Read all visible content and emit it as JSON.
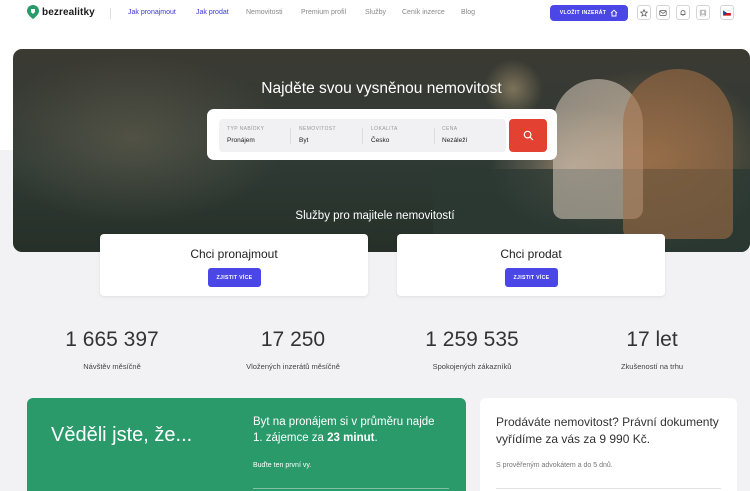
{
  "header": {
    "logo_text": "bezrealitky",
    "nav": [
      {
        "label": "Jak pronajmout",
        "active": true
      },
      {
        "label": "Jak prodat",
        "active": true
      },
      {
        "label": "Nemovitosti",
        "active": false
      },
      {
        "label": "Premium profil",
        "active": false
      },
      {
        "label": "Služby",
        "active": false
      },
      {
        "label": "Ceník inzerce",
        "active": false
      },
      {
        "label": "Blog",
        "active": false
      }
    ],
    "cta_label": "VLOŽIT INZERÁT",
    "icons": [
      "star-icon",
      "mail-icon",
      "bell-icon",
      "user-icon",
      "cz-flag-icon"
    ]
  },
  "hero": {
    "title": "Najděte svou vysněnou nemovitost",
    "search": {
      "fields": [
        {
          "label": "TYP NABÍDKY",
          "value": "Pronájem"
        },
        {
          "label": "NEMOVITOST",
          "value": "Byt"
        },
        {
          "label": "LOKALITA",
          "value": "Česko"
        },
        {
          "label": "CENA",
          "value": "Nezáleží"
        }
      ],
      "button_icon": "search-icon"
    },
    "services_title": "Služby pro majitele nemovitostí"
  },
  "cards": [
    {
      "title": "Chci pronajmout",
      "button": "ZJISTIT VÍCE"
    },
    {
      "title": "Chci prodat",
      "button": "ZJISTIT VÍCE"
    }
  ],
  "stats": [
    {
      "value": "1 665 397",
      "label": "Návštěv měsíčně"
    },
    {
      "value": "17 250",
      "label": "Vložených inzerátů měsíčně"
    },
    {
      "value": "1 259 535",
      "label": "Spokojených zákazníků"
    },
    {
      "value": "17 let",
      "label": "Zkušeností na trhu"
    }
  ],
  "green_card": {
    "heading": "Věděli jste, že...",
    "text_before": "Byt na pronájem si v průměru najde 1. zájemce za ",
    "text_bold": "23 minut",
    "text_after": ".",
    "sub": "Buďte ten první vy."
  },
  "white_card": {
    "heading": "Prodáváte nemovitost? Právní dokumenty vyřídíme za vás za 9 990 Kč.",
    "sub": "S prověřeným advokátem a do 5 dnů."
  },
  "colors": {
    "accent": "#4b47e6",
    "brand_green": "#2a9a6b",
    "search_red": "#e34233"
  }
}
